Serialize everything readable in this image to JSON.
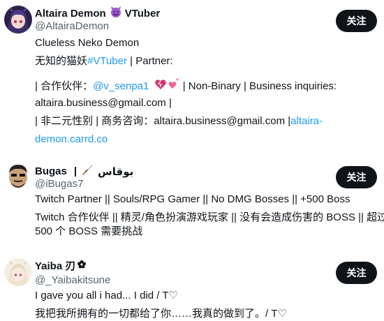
{
  "users": [
    {
      "display_name": "Altaira Demon",
      "name_suffix": "VTuber",
      "handle": "@AltairaDemon",
      "follow_label": "关注",
      "bio": {
        "line1": "Clueless Neko Demon",
        "line2_pre": "无知的猫妖",
        "line2_link": "#VTuber",
        "line2_post": " | Partner:",
        "line3_pre": "| 合作伙伴：",
        "line3_link": "@v_senpa1",
        "line3_post": " | Non-Binary | Business inquiries:",
        "line4": "altaira.business@gmail.com |",
        "line5_pre": "| 非二元性别 | 商务咨询：altaira.business@gmail.com |",
        "line5_link": "altaira-",
        "line6_link": "demon.carrd.co"
      }
    },
    {
      "display_name": "Bugas",
      "name_suffix": "بوقاس",
      "name_separator": "|",
      "handle": "@iBugas7",
      "follow_label": "关注",
      "bio": {
        "line1": "Twitch Partner || Souls/RPG Gamer || No DMG Bosses || +500 Boss",
        "line2": "Twitch 合作伙伴 || 精灵/角色扮演游戏玩家 || 没有会造成伤害的 BOSS || 超过",
        "line3": "500 个 BOSS 需要挑战"
      }
    },
    {
      "display_name": "Yaiba 刃",
      "handle": "@_Yaibakitsune",
      "follow_label": "关注",
      "bio": {
        "line1": "I gave you all i had... I did / T♡",
        "line2": "我把我所拥有的一切都给了你……我真的做到了。/ T♡"
      }
    }
  ],
  "colors": {
    "text": "#0f1419",
    "secondary": "#536471",
    "link": "#1d9bf0",
    "button_bg": "#0f1419",
    "button_text": "#ffffff"
  },
  "icons": [
    "smiling-devil-emoji",
    "dagger-emoji",
    "flower-emoji",
    "hearts-emoji"
  ]
}
